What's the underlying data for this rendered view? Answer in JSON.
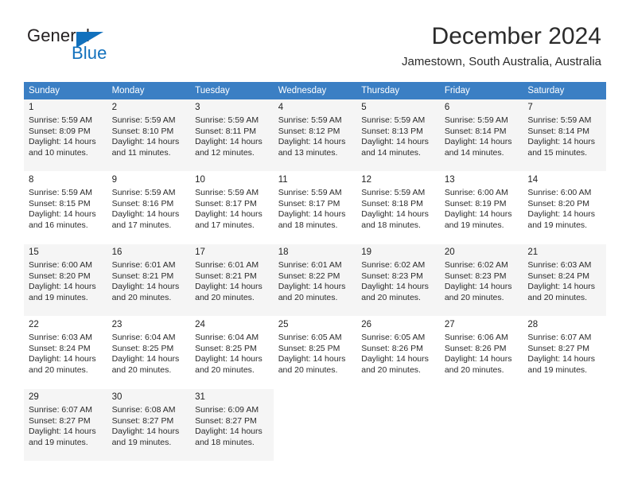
{
  "brand": {
    "line1": "General",
    "line2": "Blue",
    "logo_icon": "triangle-flag-icon",
    "accent_color": "#1271bd"
  },
  "header": {
    "title": "December 2024",
    "location": "Jamestown, South Australia, Australia"
  },
  "theme": {
    "header_row_bg": "#3b7fc4",
    "alt_row_bg": "#f5f5f5",
    "text_color": "#2b2b2b"
  },
  "weekdays": [
    "Sunday",
    "Monday",
    "Tuesday",
    "Wednesday",
    "Thursday",
    "Friday",
    "Saturday"
  ],
  "weeks": [
    [
      {
        "day": "1",
        "sunrise": "Sunrise: 5:59 AM",
        "sunset": "Sunset: 8:09 PM",
        "daylight1": "Daylight: 14 hours",
        "daylight2": "and 10 minutes."
      },
      {
        "day": "2",
        "sunrise": "Sunrise: 5:59 AM",
        "sunset": "Sunset: 8:10 PM",
        "daylight1": "Daylight: 14 hours",
        "daylight2": "and 11 minutes."
      },
      {
        "day": "3",
        "sunrise": "Sunrise: 5:59 AM",
        "sunset": "Sunset: 8:11 PM",
        "daylight1": "Daylight: 14 hours",
        "daylight2": "and 12 minutes."
      },
      {
        "day": "4",
        "sunrise": "Sunrise: 5:59 AM",
        "sunset": "Sunset: 8:12 PM",
        "daylight1": "Daylight: 14 hours",
        "daylight2": "and 13 minutes."
      },
      {
        "day": "5",
        "sunrise": "Sunrise: 5:59 AM",
        "sunset": "Sunset: 8:13 PM",
        "daylight1": "Daylight: 14 hours",
        "daylight2": "and 14 minutes."
      },
      {
        "day": "6",
        "sunrise": "Sunrise: 5:59 AM",
        "sunset": "Sunset: 8:14 PM",
        "daylight1": "Daylight: 14 hours",
        "daylight2": "and 14 minutes."
      },
      {
        "day": "7",
        "sunrise": "Sunrise: 5:59 AM",
        "sunset": "Sunset: 8:14 PM",
        "daylight1": "Daylight: 14 hours",
        "daylight2": "and 15 minutes."
      }
    ],
    [
      {
        "day": "8",
        "sunrise": "Sunrise: 5:59 AM",
        "sunset": "Sunset: 8:15 PM",
        "daylight1": "Daylight: 14 hours",
        "daylight2": "and 16 minutes."
      },
      {
        "day": "9",
        "sunrise": "Sunrise: 5:59 AM",
        "sunset": "Sunset: 8:16 PM",
        "daylight1": "Daylight: 14 hours",
        "daylight2": "and 17 minutes."
      },
      {
        "day": "10",
        "sunrise": "Sunrise: 5:59 AM",
        "sunset": "Sunset: 8:17 PM",
        "daylight1": "Daylight: 14 hours",
        "daylight2": "and 17 minutes."
      },
      {
        "day": "11",
        "sunrise": "Sunrise: 5:59 AM",
        "sunset": "Sunset: 8:17 PM",
        "daylight1": "Daylight: 14 hours",
        "daylight2": "and 18 minutes."
      },
      {
        "day": "12",
        "sunrise": "Sunrise: 5:59 AM",
        "sunset": "Sunset: 8:18 PM",
        "daylight1": "Daylight: 14 hours",
        "daylight2": "and 18 minutes."
      },
      {
        "day": "13",
        "sunrise": "Sunrise: 6:00 AM",
        "sunset": "Sunset: 8:19 PM",
        "daylight1": "Daylight: 14 hours",
        "daylight2": "and 19 minutes."
      },
      {
        "day": "14",
        "sunrise": "Sunrise: 6:00 AM",
        "sunset": "Sunset: 8:20 PM",
        "daylight1": "Daylight: 14 hours",
        "daylight2": "and 19 minutes."
      }
    ],
    [
      {
        "day": "15",
        "sunrise": "Sunrise: 6:00 AM",
        "sunset": "Sunset: 8:20 PM",
        "daylight1": "Daylight: 14 hours",
        "daylight2": "and 19 minutes."
      },
      {
        "day": "16",
        "sunrise": "Sunrise: 6:01 AM",
        "sunset": "Sunset: 8:21 PM",
        "daylight1": "Daylight: 14 hours",
        "daylight2": "and 20 minutes."
      },
      {
        "day": "17",
        "sunrise": "Sunrise: 6:01 AM",
        "sunset": "Sunset: 8:21 PM",
        "daylight1": "Daylight: 14 hours",
        "daylight2": "and 20 minutes."
      },
      {
        "day": "18",
        "sunrise": "Sunrise: 6:01 AM",
        "sunset": "Sunset: 8:22 PM",
        "daylight1": "Daylight: 14 hours",
        "daylight2": "and 20 minutes."
      },
      {
        "day": "19",
        "sunrise": "Sunrise: 6:02 AM",
        "sunset": "Sunset: 8:23 PM",
        "daylight1": "Daylight: 14 hours",
        "daylight2": "and 20 minutes."
      },
      {
        "day": "20",
        "sunrise": "Sunrise: 6:02 AM",
        "sunset": "Sunset: 8:23 PM",
        "daylight1": "Daylight: 14 hours",
        "daylight2": "and 20 minutes."
      },
      {
        "day": "21",
        "sunrise": "Sunrise: 6:03 AM",
        "sunset": "Sunset: 8:24 PM",
        "daylight1": "Daylight: 14 hours",
        "daylight2": "and 20 minutes."
      }
    ],
    [
      {
        "day": "22",
        "sunrise": "Sunrise: 6:03 AM",
        "sunset": "Sunset: 8:24 PM",
        "daylight1": "Daylight: 14 hours",
        "daylight2": "and 20 minutes."
      },
      {
        "day": "23",
        "sunrise": "Sunrise: 6:04 AM",
        "sunset": "Sunset: 8:25 PM",
        "daylight1": "Daylight: 14 hours",
        "daylight2": "and 20 minutes."
      },
      {
        "day": "24",
        "sunrise": "Sunrise: 6:04 AM",
        "sunset": "Sunset: 8:25 PM",
        "daylight1": "Daylight: 14 hours",
        "daylight2": "and 20 minutes."
      },
      {
        "day": "25",
        "sunrise": "Sunrise: 6:05 AM",
        "sunset": "Sunset: 8:25 PM",
        "daylight1": "Daylight: 14 hours",
        "daylight2": "and 20 minutes."
      },
      {
        "day": "26",
        "sunrise": "Sunrise: 6:05 AM",
        "sunset": "Sunset: 8:26 PM",
        "daylight1": "Daylight: 14 hours",
        "daylight2": "and 20 minutes."
      },
      {
        "day": "27",
        "sunrise": "Sunrise: 6:06 AM",
        "sunset": "Sunset: 8:26 PM",
        "daylight1": "Daylight: 14 hours",
        "daylight2": "and 20 minutes."
      },
      {
        "day": "28",
        "sunrise": "Sunrise: 6:07 AM",
        "sunset": "Sunset: 8:27 PM",
        "daylight1": "Daylight: 14 hours",
        "daylight2": "and 19 minutes."
      }
    ],
    [
      {
        "day": "29",
        "sunrise": "Sunrise: 6:07 AM",
        "sunset": "Sunset: 8:27 PM",
        "daylight1": "Daylight: 14 hours",
        "daylight2": "and 19 minutes."
      },
      {
        "day": "30",
        "sunrise": "Sunrise: 6:08 AM",
        "sunset": "Sunset: 8:27 PM",
        "daylight1": "Daylight: 14 hours",
        "daylight2": "and 19 minutes."
      },
      {
        "day": "31",
        "sunrise": "Sunrise: 6:09 AM",
        "sunset": "Sunset: 8:27 PM",
        "daylight1": "Daylight: 14 hours",
        "daylight2": "and 18 minutes."
      },
      null,
      null,
      null,
      null
    ]
  ]
}
